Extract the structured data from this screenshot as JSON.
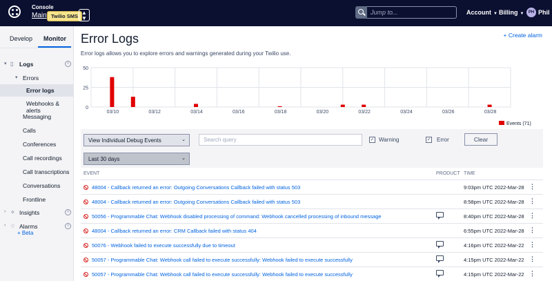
{
  "topbar": {
    "console_label": "Console",
    "account_link": "Main",
    "project_badge": "Twilio SMS",
    "search_placeholder": "Jump to...",
    "menu": [
      {
        "label": "Account"
      },
      {
        "label": "Billing"
      },
      {
        "label": "Phil"
      }
    ],
    "avatar_initials": "PH",
    "bg_color": "#0b1031"
  },
  "sidebar": {
    "tabs": [
      {
        "label": "Develop"
      },
      {
        "label": "Monitor"
      }
    ],
    "active_tab": "Monitor",
    "items": [
      {
        "label": "Logs",
        "icon": "book-icon",
        "expanded": true
      },
      {
        "label": "Errors",
        "expanded": true
      },
      {
        "label": "Error logs",
        "active": true
      },
      {
        "label": "Webhooks & alerts"
      },
      {
        "label": "Messaging"
      },
      {
        "label": "Calls"
      },
      {
        "label": "Conferences"
      },
      {
        "label": "Call recordings"
      },
      {
        "label": "Call transcriptions"
      },
      {
        "label": "Conversations"
      },
      {
        "label": "Frontline"
      },
      {
        "label": "Insights",
        "icon": "bulb-icon"
      },
      {
        "label": "Alarms",
        "icon": "bell-icon"
      }
    ],
    "beta": "+ Beta"
  },
  "page": {
    "title": "Error Logs",
    "create_alarm": "+ Create alarm",
    "description": "Error logs allows you to explore errors and warnings generated during your Twilio use."
  },
  "chart_data": {
    "type": "bar",
    "y_ticks": [
      "50",
      "25",
      "0"
    ],
    "ylim": [
      0,
      50
    ],
    "x_ticks": [
      "03/10",
      "03/12",
      "03/14",
      "03/16",
      "03/18",
      "03/20",
      "03/22",
      "03/24",
      "03/26",
      "03/28"
    ],
    "series": [
      {
        "name": "Events (71)",
        "color": "#e00000",
        "points": [
          {
            "date": "03/10",
            "value": 38
          },
          {
            "date": "03/11",
            "value": 13
          },
          {
            "date": "03/14",
            "value": 4
          },
          {
            "date": "03/18",
            "value": 1
          },
          {
            "date": "03/21",
            "value": 3
          },
          {
            "date": "03/22",
            "value": 3
          },
          {
            "date": "03/28",
            "value": 3
          }
        ]
      }
    ],
    "legend": "bottom-right",
    "grid": true
  },
  "filters": {
    "debug_select": "View Individual Debug Events",
    "search_placeholder": "Search query",
    "warning_label": "Warning",
    "warning_checked": true,
    "error_label": "Error",
    "error_checked": true,
    "clear_label": "Clear",
    "range_select": "Last 30 days"
  },
  "table": {
    "columns": [
      "EVENT",
      "PRODUCT",
      "TIME"
    ],
    "rows": [
      {
        "event": "48004 - Callback returned an error: Outgoing Conversations Callback failed with status 503",
        "product_icon": false,
        "time": "9:03pm UTC 2022-Mar-28"
      },
      {
        "event": "48004 - Callback returned an error: Outgoing Conversations Callback failed with status 503",
        "product_icon": false,
        "time": "8:58pm UTC 2022-Mar-28"
      },
      {
        "event": "50056 - Programmable Chat: Webhook disabled processing of command: Webhook cancelled processing of inbound message",
        "product_icon": true,
        "time": "8:40pm UTC 2022-Mar-28"
      },
      {
        "event": "48004 - Callback returned an error: CRM Callback failed with status 404",
        "product_icon": false,
        "time": "6:55pm UTC 2022-Mar-28"
      },
      {
        "event": "50076 - Webhook failed to execute successfully due to timeout",
        "product_icon": true,
        "time": "4:16pm UTC 2022-Mar-22"
      },
      {
        "event": "50057 - Programmable Chat: Webhook call failed to execute successfully: Webhook failed to execute successfully",
        "product_icon": true,
        "time": "4:15pm UTC 2022-Mar-22"
      },
      {
        "event": "50057 - Programmable Chat: Webhook call failed to execute successfully: Webhook failed to execute successfully",
        "product_icon": true,
        "time": "4:15pm UTC 2022-Mar-22"
      }
    ]
  }
}
